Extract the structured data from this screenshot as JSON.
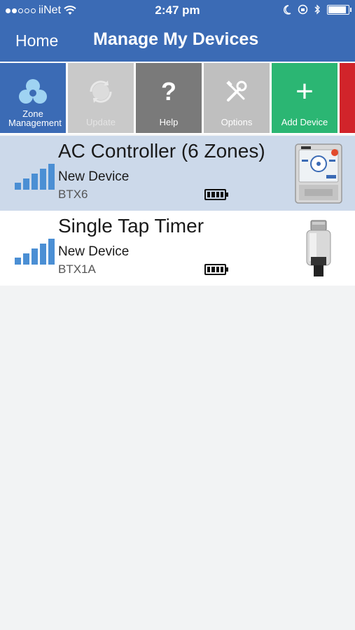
{
  "status_bar": {
    "carrier": "iiNet",
    "time": "2:47 pm",
    "signal_dots_filled": 2,
    "signal_dots_total": 5,
    "icons": [
      "wifi-icon",
      "moon-icon",
      "rotation-lock-icon",
      "bluetooth-icon",
      "battery-icon"
    ],
    "battery_level": 0.9
  },
  "nav": {
    "back_label": "Home",
    "title": "Manage My Devices"
  },
  "toolbar": {
    "items": [
      {
        "label": "Zone Management",
        "icon": "zone-management-icon",
        "color": "#3b6bb5"
      },
      {
        "label": "Update",
        "icon": "update-icon",
        "color": "#c9c9c9"
      },
      {
        "label": "Help",
        "icon": "help-icon",
        "color": "#7a7a7a"
      },
      {
        "label": "Options",
        "icon": "options-icon",
        "color": "#bfbfbf"
      },
      {
        "label": "Add Device",
        "icon": "add-icon",
        "color": "#2bb673"
      }
    ],
    "help_glyph": "?",
    "add_glyph": "+"
  },
  "devices": [
    {
      "name": "AC Controller (6 Zones)",
      "status": "New Device",
      "model": "BTX6",
      "signal_level": 5,
      "battery_level": 1.0,
      "image": "ac-controller-image",
      "selected": true
    },
    {
      "name": "Single Tap Timer",
      "status": "New Device",
      "model": "BTX1A",
      "signal_level": 5,
      "battery_level": 1.0,
      "image": "tap-timer-image",
      "selected": false
    }
  ],
  "colors": {
    "brand_blue": "#3b6bb5",
    "selected_row": "#ccd9ea",
    "signal_blue": "#4b8fd4",
    "add_green": "#2bb673"
  }
}
